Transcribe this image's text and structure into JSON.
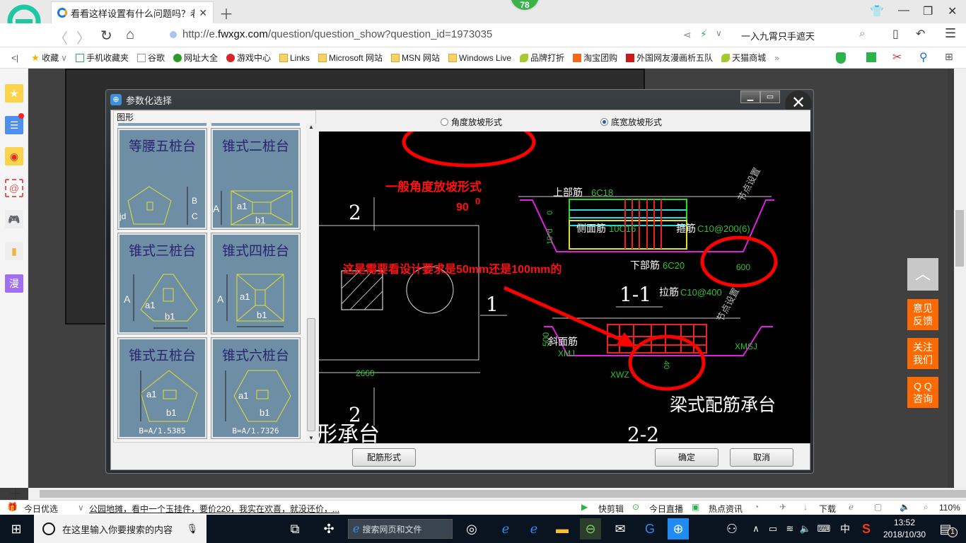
{
  "browser": {
    "tab_title": "看看这样设置有什么问题吗？老师",
    "badge_count": "78",
    "url_prefix": "http://e.",
    "url_domain": "fwxgx.com",
    "url_path": "/question/question_show?question_id=1973035",
    "search_value": "一入九霄只手遮天",
    "bookmarks": [
      {
        "label": "收藏",
        "icon": "star-icon"
      },
      {
        "label": "手机收藏夹",
        "icon": "phone-icon"
      },
      {
        "label": "谷歌",
        "icon": "page-icon"
      },
      {
        "label": "网址大全",
        "icon": "plus-circle-icon"
      },
      {
        "label": "游戏中心",
        "icon": "game-icon"
      },
      {
        "label": "Links",
        "icon": "folder-icon"
      },
      {
        "label": "Microsoft 网站",
        "icon": "folder-icon"
      },
      {
        "label": "MSN 网站",
        "icon": "folder-icon"
      },
      {
        "label": "Windows Live",
        "icon": "folder-icon"
      },
      {
        "label": "品牌打折",
        "icon": "leaf-icon"
      },
      {
        "label": "淘宝团购",
        "icon": "taobao-icon"
      },
      {
        "label": "外国网友漫画析五队",
        "icon": "bookmark-icon"
      },
      {
        "label": "天猫商城",
        "icon": "leaf-icon"
      }
    ],
    "more": "»"
  },
  "dialog": {
    "title": "参数化选择",
    "group_label": "图形",
    "shapes": [
      {
        "name": "等腰五桩台",
        "formula": ""
      },
      {
        "name": "锥式二桩台",
        "formula": ""
      },
      {
        "name": "锥式三桩台",
        "formula": ""
      },
      {
        "name": "锥式四桩台",
        "formula": ""
      },
      {
        "name": "锥式五桩台",
        "formula": "B=A/1.5385"
      },
      {
        "name": "锥式六桩台",
        "formula": "B=A/1.7326"
      }
    ],
    "radio_options": [
      {
        "label": "角度放坡形式",
        "checked": false
      },
      {
        "label": "底宽放坡形式",
        "checked": true
      }
    ],
    "buttons": {
      "rebar_form": "配筋形式",
      "ok": "确定",
      "cancel": "取消"
    },
    "cad": {
      "annotation_1": "一般角度放坡形式",
      "annotation_angle": "90",
      "annotation_angle_sup": "0",
      "annotation_2": "这是需要看设计要求是50mm还是100mm的",
      "top_rebar_label": "上部筋",
      "top_rebar_value": "6C18",
      "side_rebar_label": "侧面筋",
      "side_rebar_value": "10C16",
      "stirrup_label": "箍筋",
      "stirrup_value": "C10@200(6)",
      "bottom_rebar_label": "下部筋",
      "bottom_rebar_value": "6C20",
      "node_setting": "节点设置",
      "dim_600": "600",
      "dim_10d": "10*d",
      "dim_0": "0",
      "section_11": "1-1",
      "section_22": "2-2",
      "tie_label": "拉筋",
      "tie_value": "C10@400",
      "slope_label": "斜面筋",
      "xmj": "XMJ",
      "xmsj": "XMSJ",
      "xwz": "XWZ",
      "dim_500": "500",
      "dim_40": "40",
      "dim_2660": "2660",
      "label_2": "2",
      "label_1": "1",
      "title_beam": "梁式配筋承台",
      "title_shape": "形承台"
    }
  },
  "float_buttons": [
    "意见\n反馈",
    "关注\n我们",
    "Q Q\n咨询"
  ],
  "status_bar": {
    "today_pick": "今日优选",
    "news": "公园地摊，看中一个玉挂件，要价220，我实在欢喜，就没还价，...",
    "quick_edit": "快剪辑",
    "live": "今日直播",
    "hot_news": "热点资讯",
    "download": "下载",
    "zoom": "110%"
  },
  "taskbar": {
    "search_placeholder": "在这里输入你要搜索的内容",
    "web_search": "搜索网页和文件",
    "ime": "中",
    "time": "13:52",
    "date": "2018/10/30",
    "notifications": "1"
  }
}
